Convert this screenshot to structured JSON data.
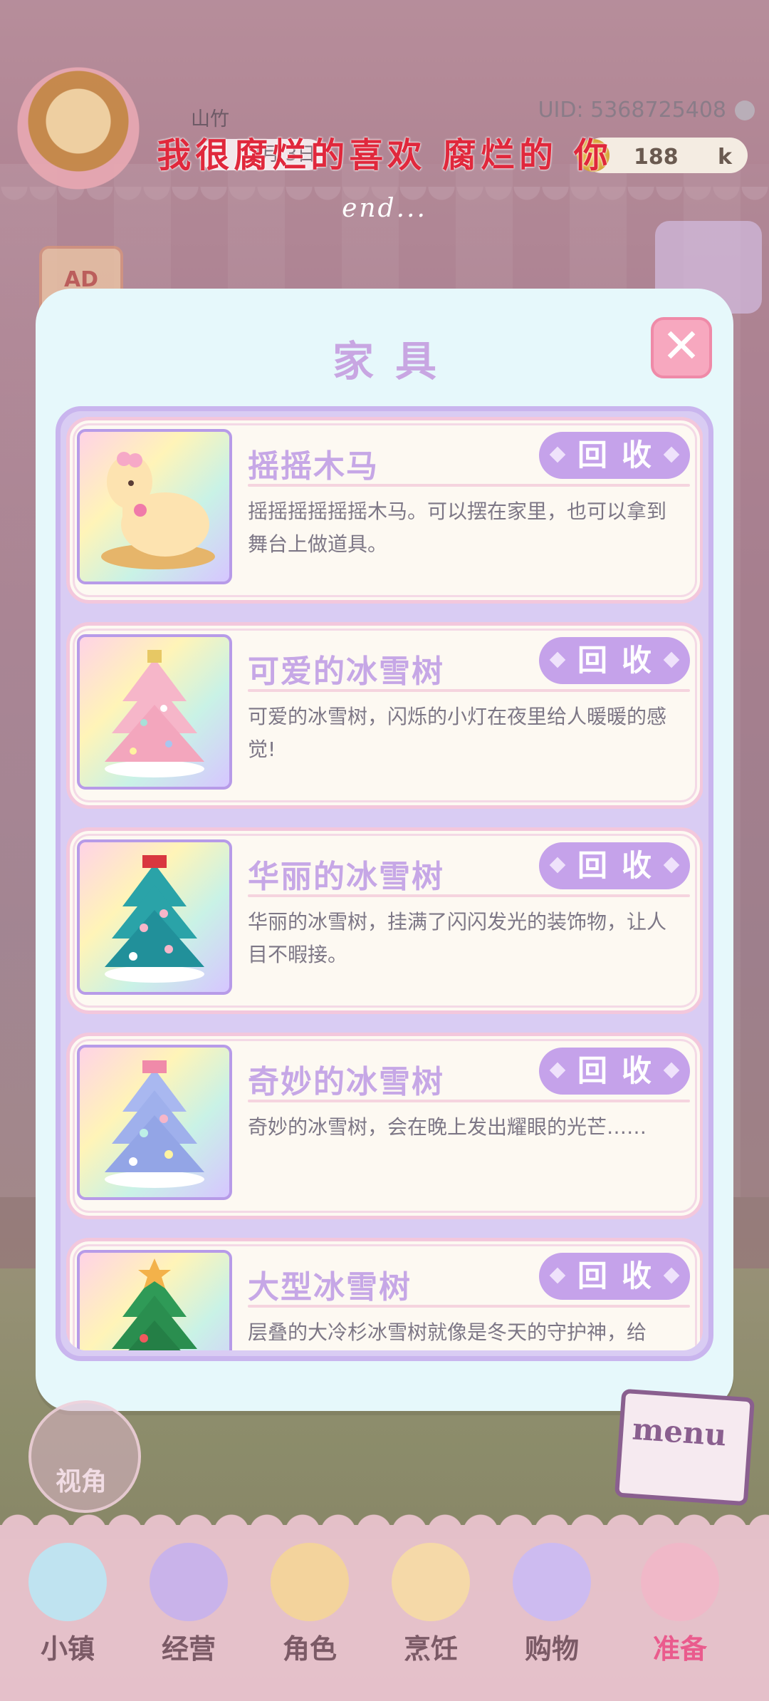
{
  "header": {
    "player_name": "山竹",
    "uid": "UID: 5368725408",
    "date_fragment": "2月 3日",
    "coins": "188",
    "coins_unit": "k",
    "ad_label": "AD"
  },
  "lyric": {
    "line": "我很腐烂的喜欢 腐烂的 你",
    "end": "end..."
  },
  "modal": {
    "title": "家具",
    "close_symbol": "✕",
    "items": [
      {
        "name": "摇摇木马",
        "desc": "摇摇摇摇摇摇木马。可以摆在家里，也可以拿到舞台上做道具。",
        "button": "回收"
      },
      {
        "name": "可爱的冰雪树",
        "desc": "可爱的冰雪树，闪烁的小灯在夜里给人暖暖的感觉!",
        "button": "回收"
      },
      {
        "name": "华丽的冰雪树",
        "desc": "华丽的冰雪树，挂满了闪闪发光的装饰物，让人目不暇接。",
        "button": "回收"
      },
      {
        "name": "奇妙的冰雪树",
        "desc": "奇妙的冰雪树，会在晚上发出耀眼的光芒……",
        "button": "回收"
      },
      {
        "name": "大型冰雪树",
        "desc": "层叠的大冷杉冰雪树就像是冬天的守护神，给",
        "button": "回收"
      }
    ]
  },
  "side": {
    "view_label": "视角",
    "menu_label": "menu"
  },
  "nav": [
    {
      "label": "小镇",
      "icon": "map-icon",
      "color": "#bfe3f0"
    },
    {
      "label": "经营",
      "icon": "hat-icon",
      "color": "#c9b3ea"
    },
    {
      "label": "角色",
      "icon": "character-icon",
      "color": "#f3d39c"
    },
    {
      "label": "烹饪",
      "icon": "sandwich-icon",
      "color": "#f5d9a8"
    },
    {
      "label": "购物",
      "icon": "shopping-bag-icon",
      "color": "#cdbbf0"
    },
    {
      "label": "准备",
      "icon": "basket-icon",
      "color": "#f0b8c8"
    }
  ],
  "colors": {
    "modal_bg": "#e6f8fb",
    "title": "#c8a6e2",
    "button": "#c5a2ea",
    "close": "#f7a8bf",
    "active_nav": "#ea5b8d"
  }
}
